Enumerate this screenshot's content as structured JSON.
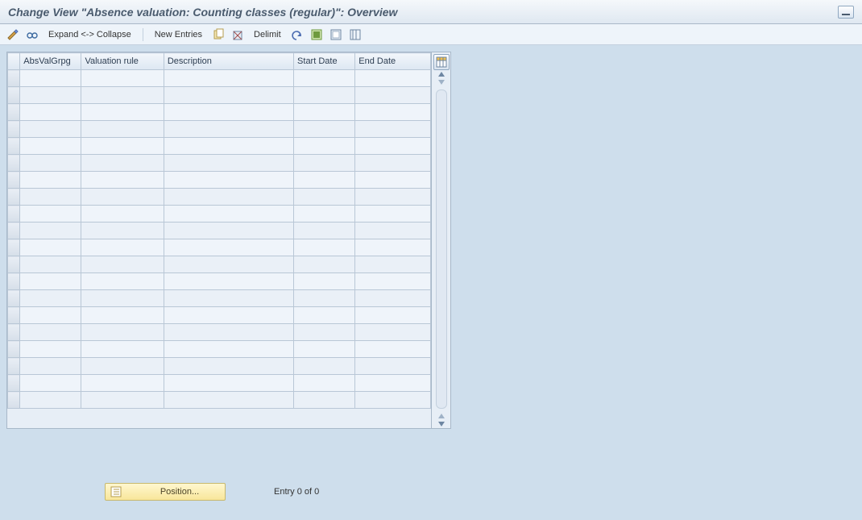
{
  "titlebar": {
    "title": "Change View \"Absence valuation: Counting classes (regular)\": Overview"
  },
  "toolbar": {
    "expand_collapse": "Expand <-> Collapse",
    "new_entries": "New Entries",
    "delimit": "Delimit"
  },
  "table": {
    "columns": [
      "AbsValGrpg",
      "Valuation rule",
      "Description",
      "Start Date",
      "End Date"
    ],
    "row_count": 20
  },
  "footer": {
    "position_label": "Position...",
    "entry_status": "Entry 0 of 0"
  }
}
